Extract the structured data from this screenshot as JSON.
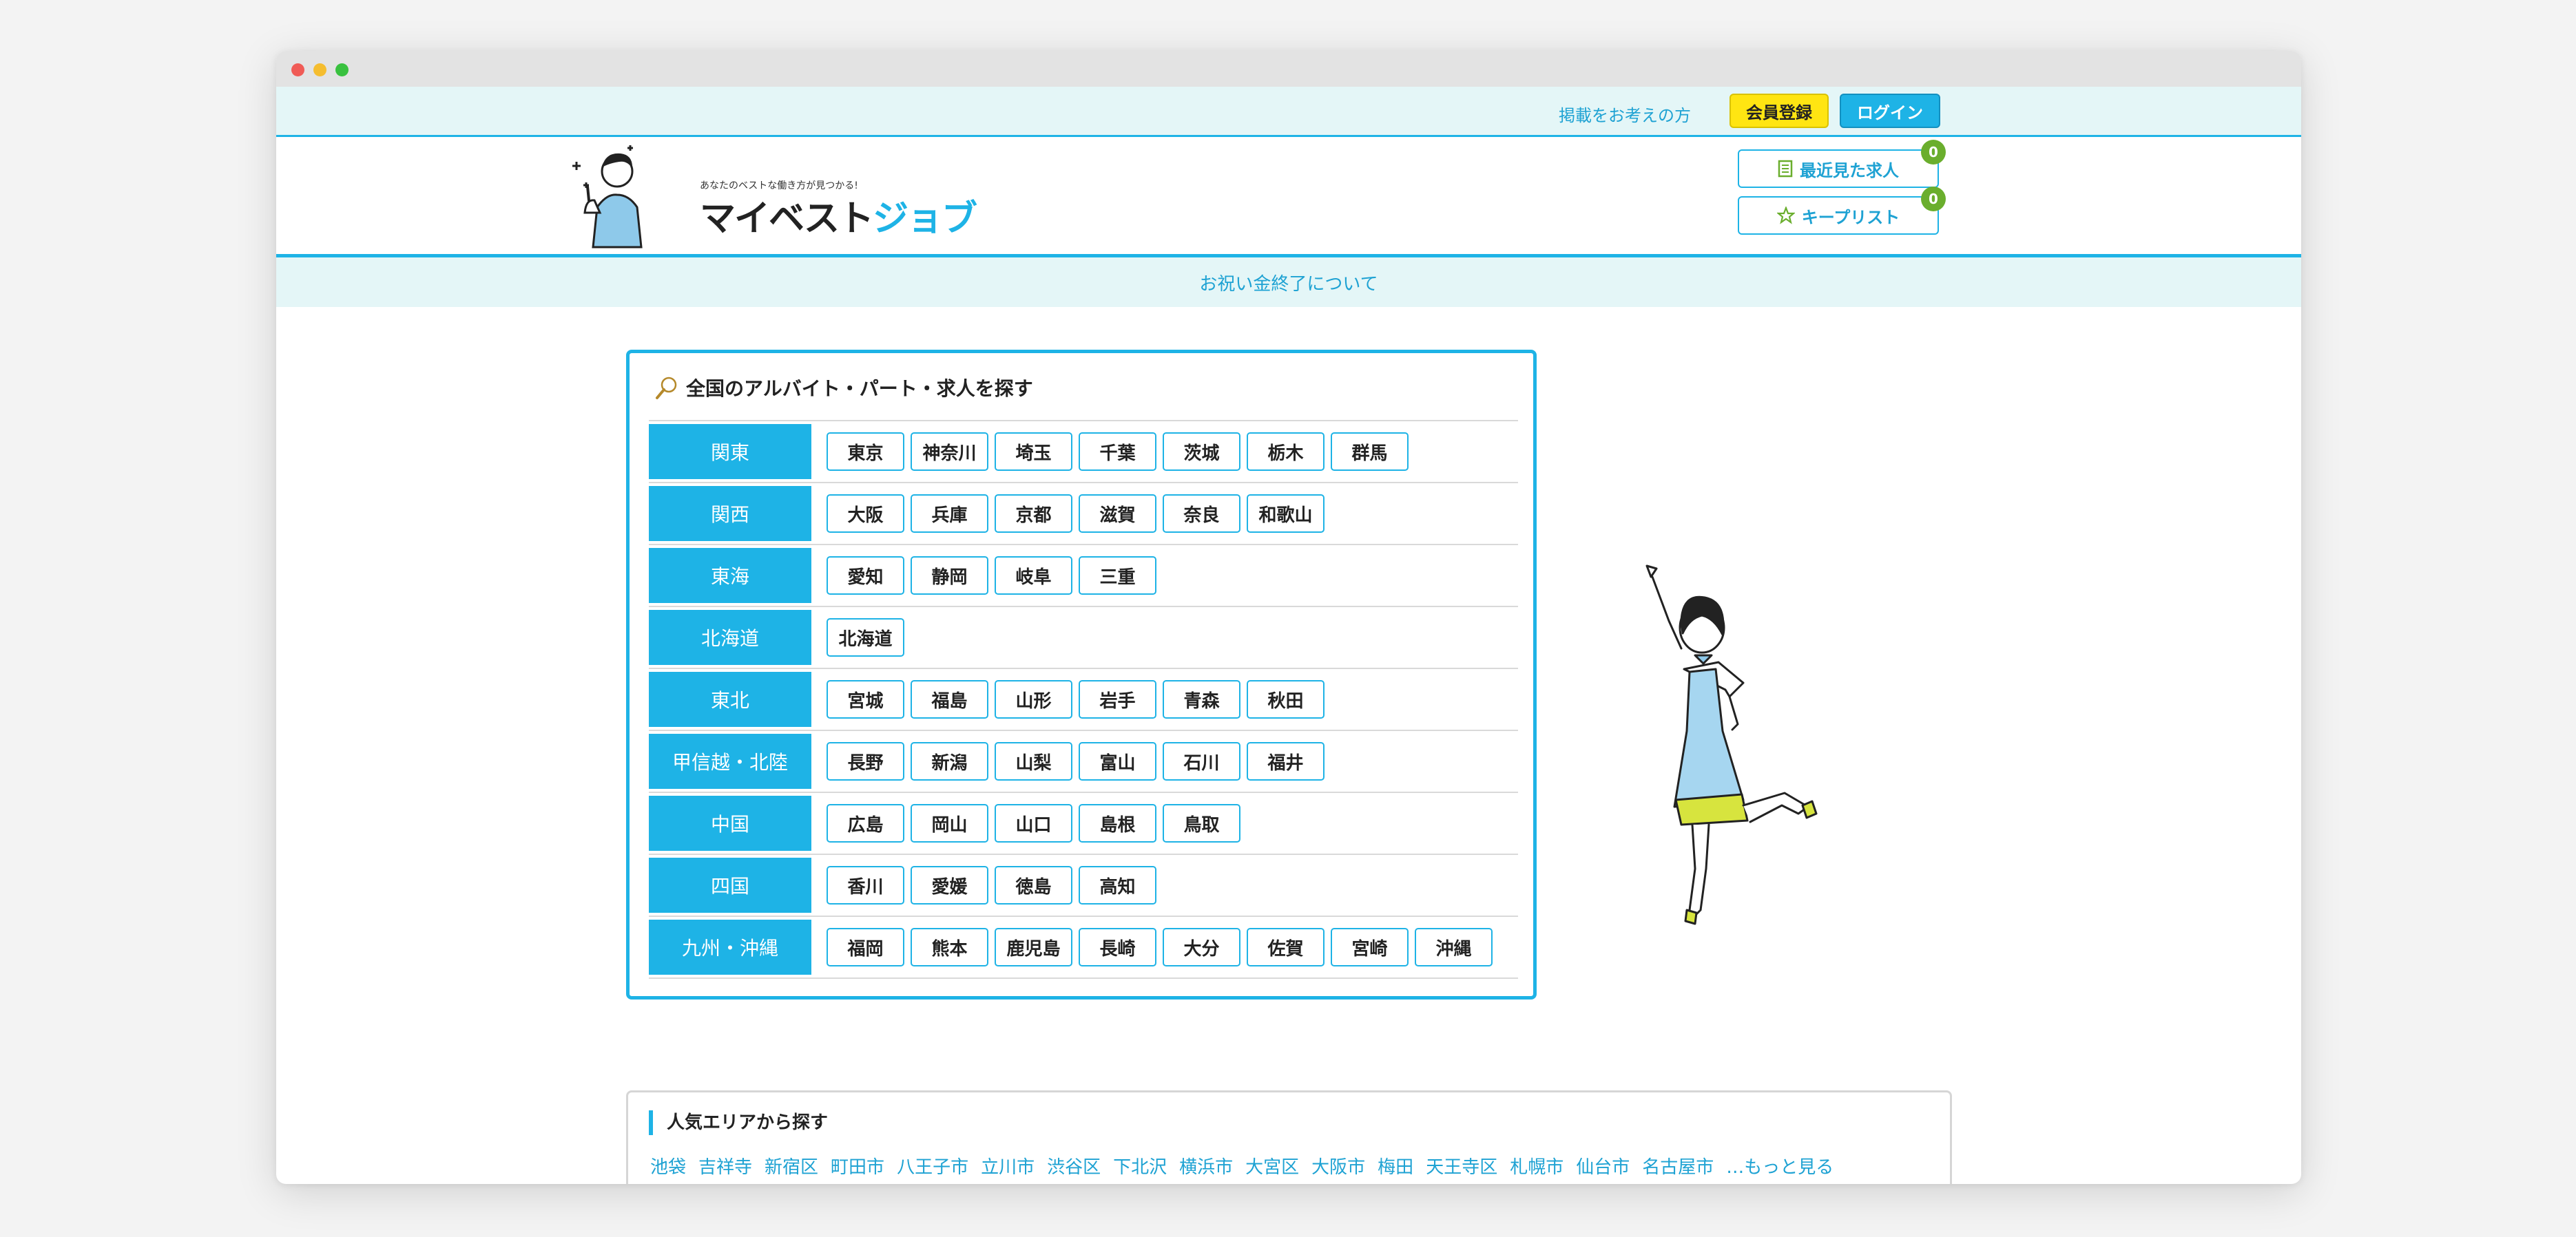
{
  "window": {
    "controls": [
      "close",
      "minimize",
      "maximize"
    ]
  },
  "topbar": {
    "advert_link": "掲載をお考えの方",
    "register_label": "会員登録",
    "login_label": "ログイン"
  },
  "header": {
    "logo_tagline": "あなたのベストな働き方が見つかる!",
    "logo_main": "マイベスト",
    "logo_accent": "ジョブ",
    "recent_label": "最近見た求人",
    "recent_count": "0",
    "keep_label": "キープリスト",
    "keep_count": "0"
  },
  "notice": {
    "text": "お祝い金終了について"
  },
  "search": {
    "title": "全国のアルバイト・パート・求人を探す",
    "regions": [
      {
        "name": "関東",
        "prefs": [
          "東京",
          "神奈川",
          "埼玉",
          "千葉",
          "茨城",
          "栃木",
          "群馬"
        ]
      },
      {
        "name": "関西",
        "prefs": [
          "大阪",
          "兵庫",
          "京都",
          "滋賀",
          "奈良",
          "和歌山"
        ]
      },
      {
        "name": "東海",
        "prefs": [
          "愛知",
          "静岡",
          "岐阜",
          "三重"
        ]
      },
      {
        "name": "北海道",
        "prefs": [
          "北海道"
        ]
      },
      {
        "name": "東北",
        "prefs": [
          "宮城",
          "福島",
          "山形",
          "岩手",
          "青森",
          "秋田"
        ]
      },
      {
        "name": "甲信越・北陸",
        "prefs": [
          "長野",
          "新潟",
          "山梨",
          "富山",
          "石川",
          "福井"
        ]
      },
      {
        "name": "中国",
        "prefs": [
          "広島",
          "岡山",
          "山口",
          "島根",
          "鳥取"
        ]
      },
      {
        "name": "四国",
        "prefs": [
          "香川",
          "愛媛",
          "徳島",
          "高知"
        ]
      },
      {
        "name": "九州・沖縄",
        "prefs": [
          "福岡",
          "熊本",
          "鹿児島",
          "長崎",
          "大分",
          "佐賀",
          "宮崎",
          "沖縄"
        ]
      }
    ]
  },
  "popular": {
    "title": "人気エリアから探す",
    "areas": [
      "池袋",
      "吉祥寺",
      "新宿区",
      "町田市",
      "八王子市",
      "立川市",
      "渋谷区",
      "下北沢",
      "横浜市",
      "大宮区",
      "大阪市",
      "梅田",
      "天王寺区",
      "札幌市",
      "仙台市",
      "名古屋市",
      "…もっと見る"
    ]
  },
  "colors": {
    "accent": "#1eb3e6",
    "register": "#ffe512",
    "badge": "#6aae2d",
    "tint": "#e4f6f7"
  }
}
